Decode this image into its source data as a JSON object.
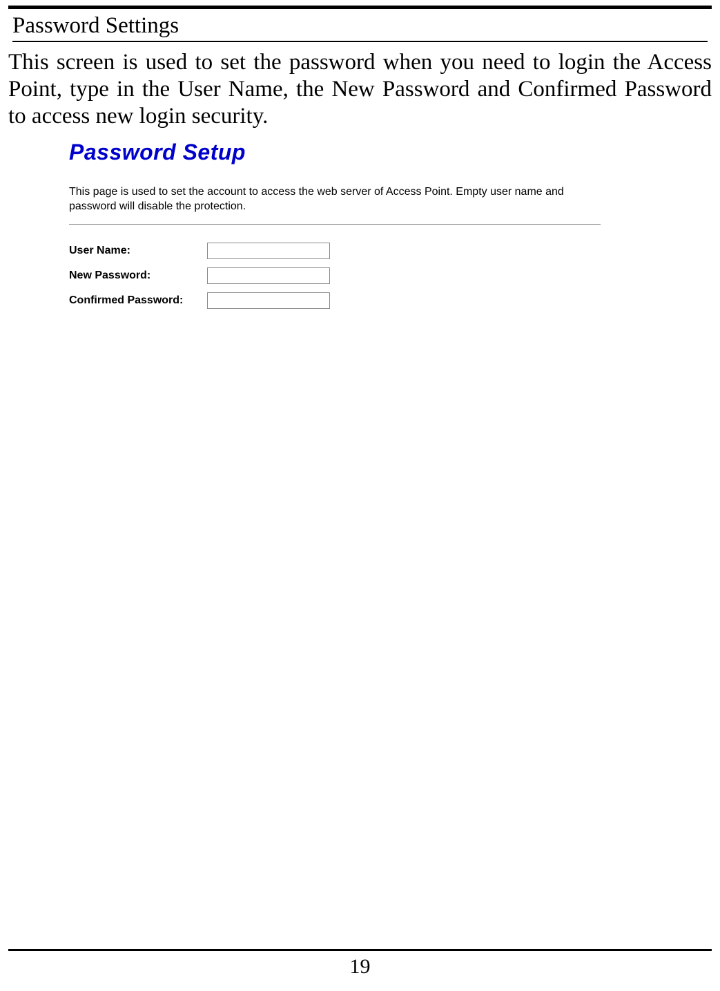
{
  "section_heading": "Password Settings",
  "intro_text": "This screen is used to set the password when you need to login the Access Point, type in the User Name, the New Password and Confirmed Password to access new login security.",
  "panel": {
    "title": "Password Setup",
    "description": "This page is used to set the account to access the web server of Access Point. Empty user name and password will disable the protection."
  },
  "form": {
    "user_name": {
      "label": "User Name:",
      "value": ""
    },
    "new_password": {
      "label": "New Password:",
      "value": ""
    },
    "confirmed_password": {
      "label": "Confirmed Password:",
      "value": ""
    }
  },
  "page_number": "19"
}
